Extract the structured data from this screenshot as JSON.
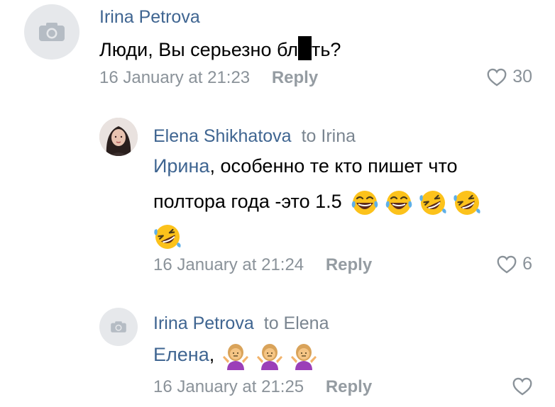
{
  "comments": [
    {
      "author": "Irina Petrova",
      "to": "",
      "text_before": "Люди, Вы серьезно бл",
      "text_after": "ть?",
      "date": "16 January at 21:23",
      "reply_label": "Reply",
      "likes": "30",
      "avatar": "camera-placeholder-icon"
    },
    {
      "author": "Elena Shikhatova",
      "to": "to Irina",
      "mention": "Ирина",
      "text_line1": ", особенно те кто пишет что",
      "text_line2": "полтора года -это 1.5",
      "emojis_line2": [
        "face-with-tears-of-joy-icon",
        "face-with-tears-of-joy-icon",
        "rolling-on-floor-laughing-icon",
        "rolling-on-floor-laughing-icon"
      ],
      "emojis_line3": [
        "rolling-on-floor-laughing-icon"
      ],
      "date": "16 January at 21:24",
      "reply_label": "Reply",
      "likes": "6",
      "avatar": "user-photo"
    },
    {
      "author": "Irina Petrova",
      "to": "to Elena",
      "mention": "Елена",
      "text": ",",
      "emojis": [
        "person-shrugging-icon",
        "person-shrugging-icon",
        "person-shrugging-icon"
      ],
      "date": "16 January at 21:25",
      "reply_label": "Reply",
      "likes": "",
      "avatar": "camera-placeholder-icon"
    }
  ],
  "colors": {
    "author": "#3f6591",
    "meta": "#8a9299",
    "avatar_bg": "#e6e8eb"
  }
}
